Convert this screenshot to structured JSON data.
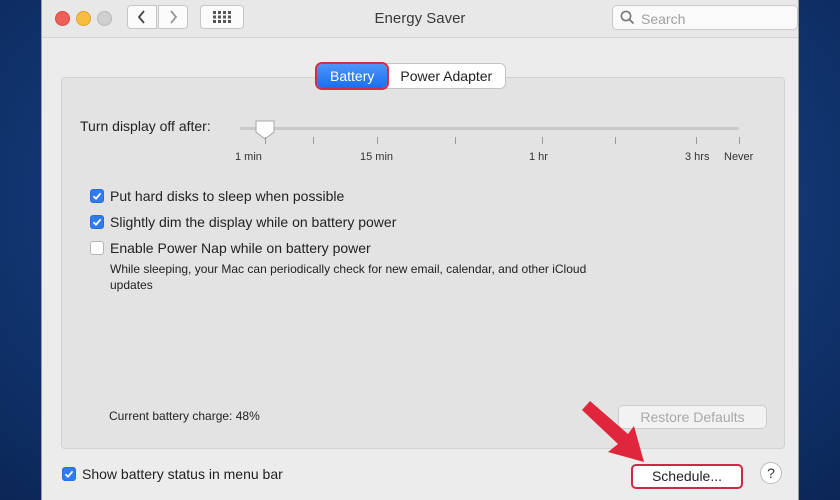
{
  "window": {
    "title": "Energy Saver",
    "search_placeholder": "Search"
  },
  "tabs": [
    {
      "label": "Battery",
      "active": true
    },
    {
      "label": "Power Adapter",
      "active": false
    }
  ],
  "slider": {
    "label": "Turn display off after:",
    "value": "1 min",
    "ticks": [
      "1 min",
      "15 min",
      "1 hr",
      "3 hrs",
      "Never"
    ]
  },
  "options": [
    {
      "label": "Put hard disks to sleep when possible",
      "checked": true
    },
    {
      "label": "Slightly dim the display while on battery power",
      "checked": true
    },
    {
      "label": "Enable Power Nap while on battery power",
      "checked": false,
      "description": "While sleeping, your Mac can periodically check for new email, calendar, and other iCloud updates"
    }
  ],
  "battery_charge": "Current battery charge: 48%",
  "buttons": {
    "restore_defaults": "Restore Defaults",
    "schedule": "Schedule...",
    "help": "?"
  },
  "menu_bar_option": {
    "label": "Show battery status in menu bar",
    "checked": true
  },
  "colors": {
    "accent": "#2f7bf6",
    "highlight_outline": "#d42d48",
    "annotation_arrow": "#e0263c"
  },
  "icons": [
    "close-icon",
    "minimize-icon",
    "zoom-icon",
    "chevron-left-icon",
    "chevron-right-icon",
    "grid-icon",
    "search-icon",
    "checkmark-icon",
    "annotation-arrow-icon"
  ]
}
